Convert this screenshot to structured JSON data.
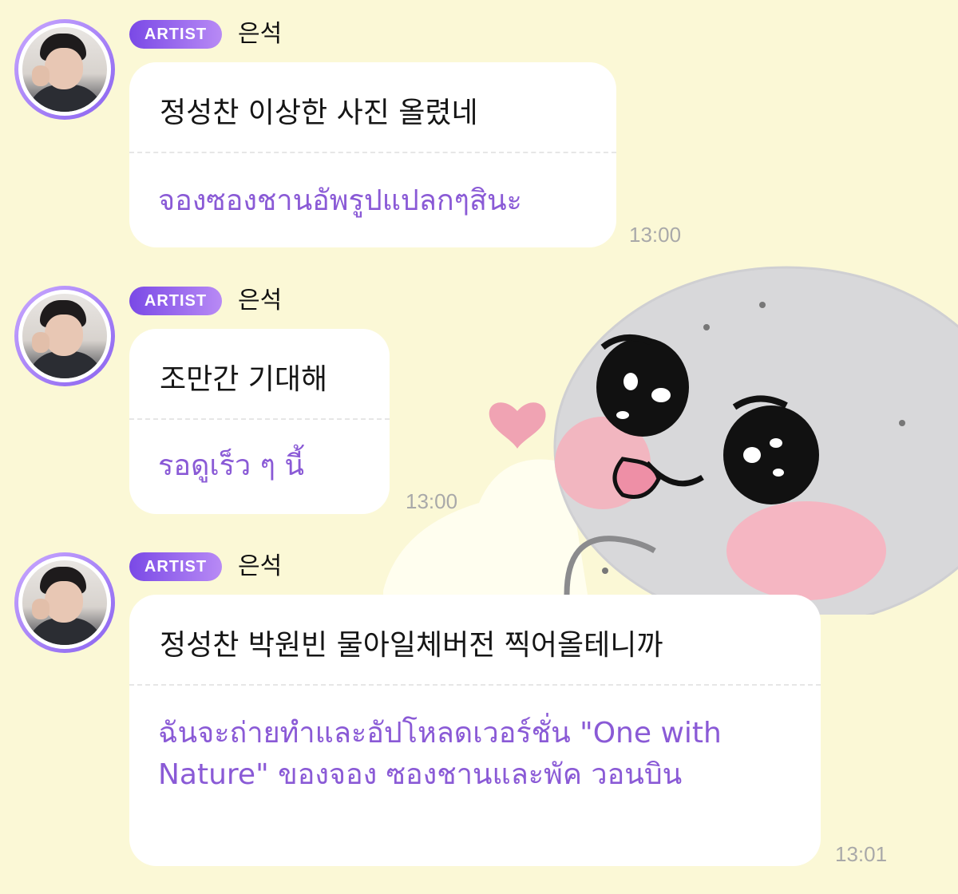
{
  "messages": [
    {
      "badge": "ARTIST",
      "sender": "은석",
      "text": "정성찬 이상한 사진 올렸네",
      "translation": "จองซองชานอัพรูปแปลกๆสินะ",
      "time": "13:00"
    },
    {
      "badge": "ARTIST",
      "sender": "은석",
      "text": "조만간 기대해",
      "translation": "รอดูเร็ว ๆ นี้",
      "time": "13:00"
    },
    {
      "badge": "ARTIST",
      "sender": "은석",
      "text": "정성찬 박원빈 물아일체버전 찍어올테니까",
      "translation": "ฉันจะถ่ายทำและอัปโหลดเวอร์ชั่น \"One with Nature\" ของจอง ซองชานและพัค วอนบิน",
      "time": "13:01"
    }
  ],
  "colors": {
    "background": "#fbf8d6",
    "badge_start": "#7a49e6",
    "badge_end": "#b88af5",
    "translation_text": "#8a5ad6",
    "timestamp": "#a9a9a9"
  },
  "icons": {
    "sticker": "cute-ghost-blob-sticker",
    "avatar": "artist-profile-photo"
  }
}
